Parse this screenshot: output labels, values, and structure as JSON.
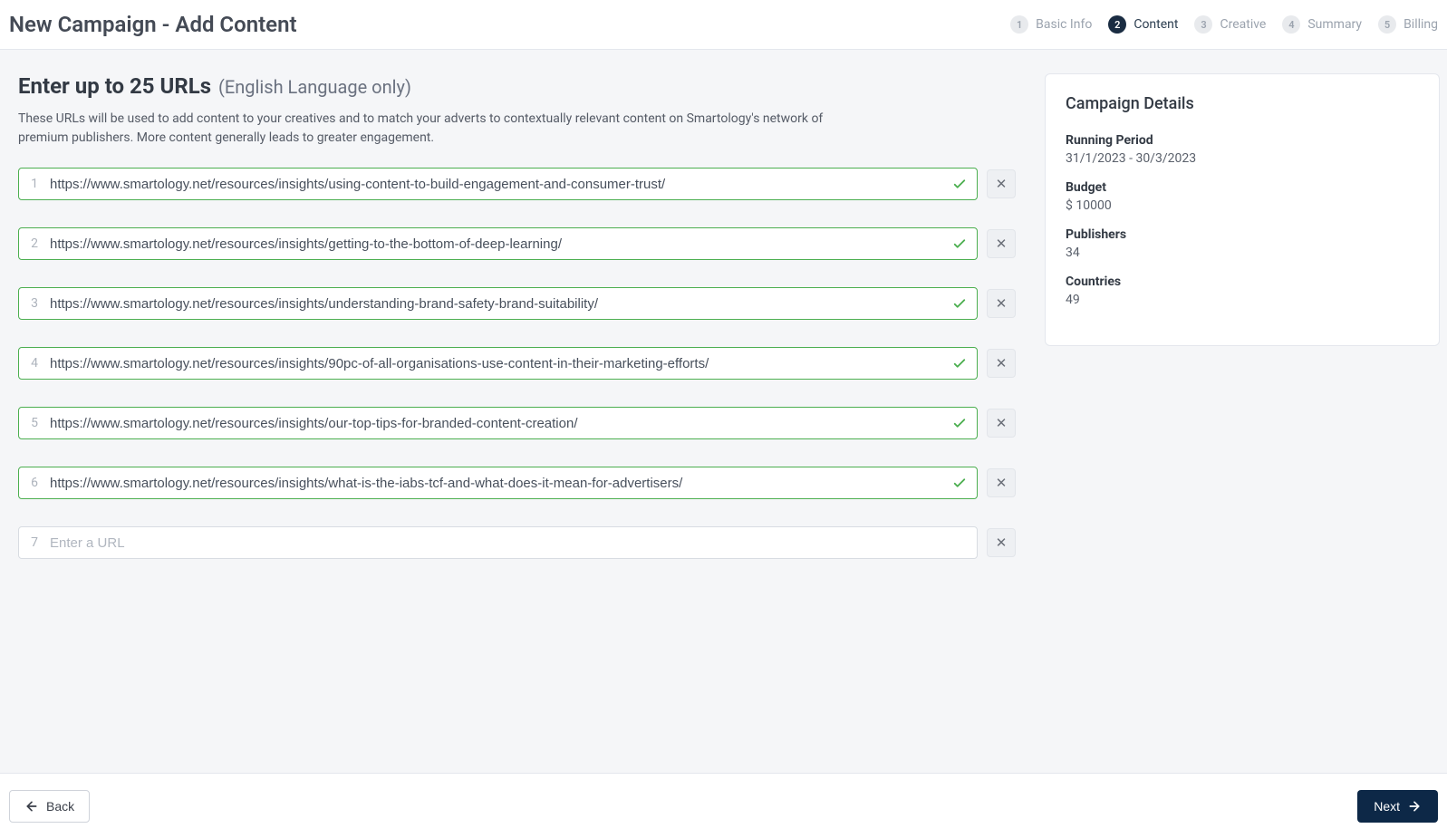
{
  "header": {
    "title": "New Campaign - Add Content",
    "steps": [
      {
        "num": "1",
        "label": "Basic Info",
        "active": false
      },
      {
        "num": "2",
        "label": "Content",
        "active": true
      },
      {
        "num": "3",
        "label": "Creative",
        "active": false
      },
      {
        "num": "4",
        "label": "Summary",
        "active": false
      },
      {
        "num": "5",
        "label": "Billing",
        "active": false
      }
    ]
  },
  "main": {
    "heading": "Enter up to 25 URLs",
    "heading_sub": "(English Language only)",
    "description": "These URLs will be used to add content to your creatives and to match your adverts to contextually relevant content on Smartology's network of premium publishers. More content generally leads to greater engagement.",
    "url_placeholder": "Enter a URL",
    "urls": [
      {
        "index": "1",
        "value": "https://www.smartology.net/resources/insights/using-content-to-build-engagement-and-consumer-trust/",
        "valid": true
      },
      {
        "index": "2",
        "value": "https://www.smartology.net/resources/insights/getting-to-the-bottom-of-deep-learning/",
        "valid": true
      },
      {
        "index": "3",
        "value": "https://www.smartology.net/resources/insights/understanding-brand-safety-brand-suitability/",
        "valid": true
      },
      {
        "index": "4",
        "value": "https://www.smartology.net/resources/insights/90pc-of-all-organisations-use-content-in-their-marketing-efforts/",
        "valid": true
      },
      {
        "index": "5",
        "value": "https://www.smartology.net/resources/insights/our-top-tips-for-branded-content-creation/",
        "valid": true
      },
      {
        "index": "6",
        "value": "https://www.smartology.net/resources/insights/what-is-the-iabs-tcf-and-what-does-it-mean-for-advertisers/",
        "valid": true
      },
      {
        "index": "7",
        "value": "",
        "valid": false
      }
    ]
  },
  "sidebar": {
    "title": "Campaign Details",
    "details": [
      {
        "label": "Running Period",
        "value": "31/1/2023 - 30/3/2023"
      },
      {
        "label": "Budget",
        "value": "$ 10000"
      },
      {
        "label": "Publishers",
        "value": "34"
      },
      {
        "label": "Countries",
        "value": "49"
      }
    ]
  },
  "footer": {
    "back_label": "Back",
    "next_label": "Next"
  }
}
